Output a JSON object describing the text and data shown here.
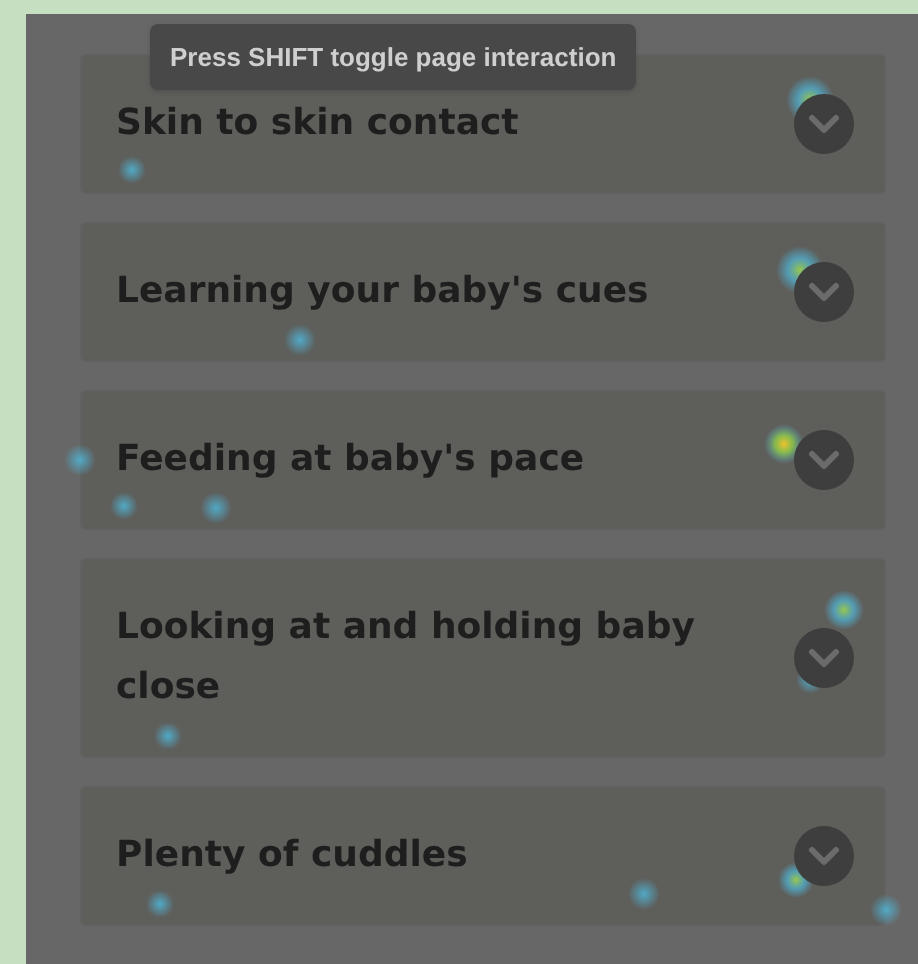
{
  "tooltip": {
    "text": "Press SHIFT toggle page interaction"
  },
  "sections": [
    {
      "title": "Skin to skin contact",
      "expanded": false
    },
    {
      "title": "Learning your baby's cues",
      "expanded": false
    },
    {
      "title": "Feeding at baby's pace",
      "expanded": false
    },
    {
      "title": "Looking at and holding baby close",
      "expanded": false
    },
    {
      "title": "Plenty of cuddles",
      "expanded": false
    }
  ]
}
